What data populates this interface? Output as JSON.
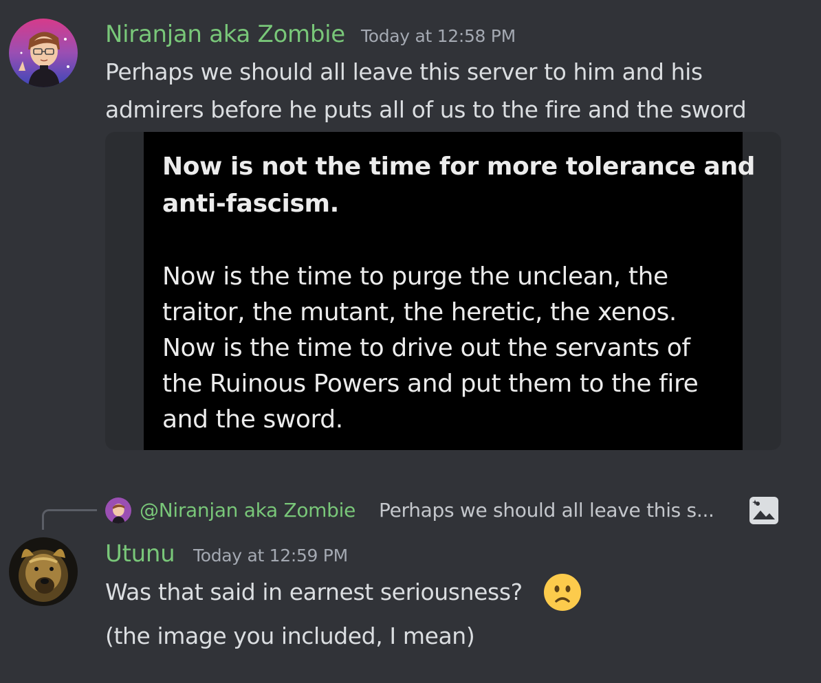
{
  "messages": [
    {
      "author": "Niranjan aka Zombie",
      "timestamp": "Today at 12:58 PM",
      "lines": [
        "Perhaps we should all leave this server to him and his",
        "admirers before he puts all of us to the fire and the sword"
      ],
      "attachment": {
        "bold_lines": [
          "Now is not the time for more tolerance and",
          "anti-fascism."
        ],
        "lines": [
          "Now is the time to purge the unclean, the",
          "traitor, the mutant, the heretic, the xenos.",
          "Now is the time to drive out the servants of",
          "the Ruinous Powers and put them to the fire",
          "and the sword."
        ]
      }
    },
    {
      "reply_to": {
        "mention": "@Niranjan aka Zombie",
        "preview": "Perhaps we should all leave this s...",
        "icon": "image-icon"
      },
      "author": "Utunu",
      "timestamp": "Today at 12:59 PM",
      "lines": [
        "Was that said in earnest seriousness?",
        "(the image you included, I mean)"
      ],
      "emoji": "slightly-frowning-face"
    }
  ],
  "colors": {
    "background": "#313338",
    "username": "#79c779",
    "text": "#dbdee1",
    "timestamp": "#a4a9b2"
  }
}
